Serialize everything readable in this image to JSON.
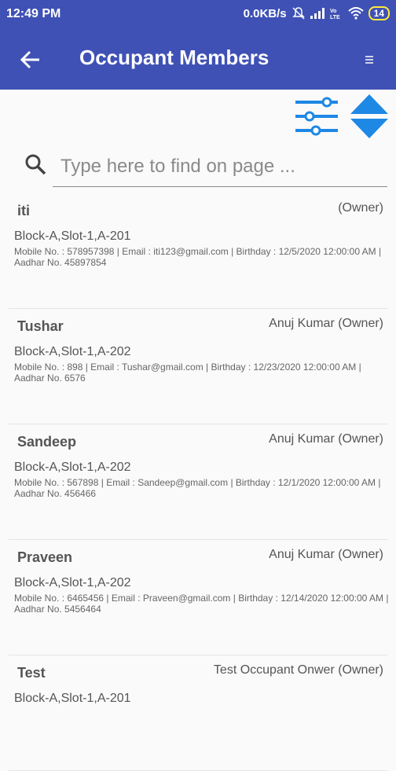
{
  "status_bar": {
    "time": "12:49 PM",
    "speed": "0.0KB/s",
    "battery": "14"
  },
  "app_bar": {
    "title": "Occupant Members"
  },
  "search": {
    "placeholder": "Type here to find on page ..."
  },
  "members": [
    {
      "name": "iti",
      "owner": "(Owner)",
      "address": "Block-A,Slot-1,A-201",
      "details": "Mobile No. : 578957398 | Email : iti123@gmail.com | Birthday : 12/5/2020 12:00:00 AM | Aadhar No. 45897854"
    },
    {
      "name": "Tushar",
      "owner": "Anuj Kumar (Owner)",
      "address": "Block-A,Slot-1,A-202",
      "details": "Mobile No. : 898 | Email : Tushar@gmail.com | Birthday : 12/23/2020 12:00:00 AM | Aadhar No. 6576"
    },
    {
      "name": "Sandeep",
      "owner": "Anuj Kumar (Owner)",
      "address": "Block-A,Slot-1,A-202",
      "details": "Mobile No. : 567898 | Email : Sandeep@gmail.com | Birthday : 12/1/2020 12:00:00 AM | Aadhar No. 456466"
    },
    {
      "name": "Praveen",
      "owner": "Anuj Kumar (Owner)",
      "address": "Block-A,Slot-1,A-202",
      "details": "Mobile No. : 6465456 | Email : Praveen@gmail.com | Birthday : 12/14/2020 12:00:00 AM | Aadhar No. 5456464"
    },
    {
      "name": "Test",
      "owner": "Test Occupant Onwer  (Owner)",
      "address": "Block-A,Slot-1,A-201",
      "details": ""
    }
  ],
  "colors": {
    "primary": "#3f51b5",
    "accent": "#1e88e5"
  },
  "icons": {
    "back": "arrow-left-icon",
    "menu": "menu-icon",
    "filter": "filter-sliders-icon",
    "sort": "sort-up-down-icon",
    "search": "search-icon"
  }
}
